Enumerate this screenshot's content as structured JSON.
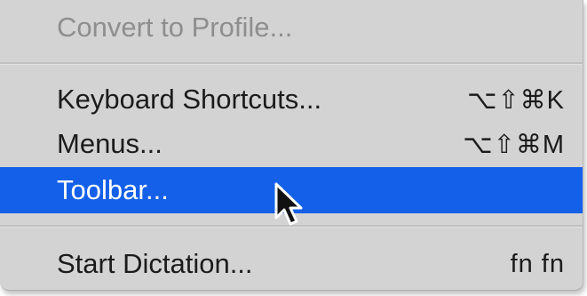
{
  "menu": {
    "items": [
      {
        "label": "Convert to Profile...",
        "shortcut": "",
        "state": "disabled"
      },
      {
        "label": "Keyboard Shortcuts...",
        "shortcut": "⌥⇧⌘K",
        "state": "normal"
      },
      {
        "label": "Menus...",
        "shortcut": "⌥⇧⌘M",
        "state": "normal"
      },
      {
        "label": "Toolbar...",
        "shortcut": "",
        "state": "highlighted"
      },
      {
        "label": "Start Dictation...",
        "shortcut": "fn fn",
        "state": "normal"
      }
    ]
  },
  "cursor": {
    "icon": "arrow-cursor-icon"
  },
  "colors": {
    "menu_background": "#d3d3d3",
    "highlight": "#1460e8",
    "disabled_text": "#8e8e8e"
  }
}
